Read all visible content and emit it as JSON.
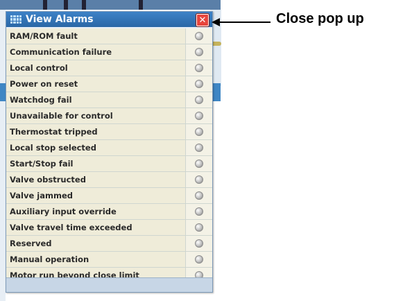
{
  "popup": {
    "title": "View Alarms",
    "close_icon_glyph": "✕",
    "alarms": [
      {
        "label": "RAM/ROM fault"
      },
      {
        "label": "Communication failure"
      },
      {
        "label": "Local control"
      },
      {
        "label": "Power on reset"
      },
      {
        "label": "Watchdog fail"
      },
      {
        "label": "Unavailable for control"
      },
      {
        "label": "Thermostat tripped"
      },
      {
        "label": "Local stop selected"
      },
      {
        "label": "Start/Stop fail"
      },
      {
        "label": "Valve obstructed"
      },
      {
        "label": "Valve jammed"
      },
      {
        "label": "Auxiliary input override"
      },
      {
        "label": "Valve travel time exceeded"
      },
      {
        "label": "Reserved"
      },
      {
        "label": "Manual operation"
      },
      {
        "label": "Motor run beyond close limit"
      }
    ]
  },
  "annotation": {
    "text": "Close pop up"
  },
  "colors": {
    "header": "#2f73b7",
    "close_button": "#e8453d",
    "row_background": "#efecd9",
    "led_inactive": "#bfbfbf"
  },
  "icons": {
    "header": "grid-icon",
    "close": "close-icon",
    "alarm_status": "status-led-icon"
  }
}
